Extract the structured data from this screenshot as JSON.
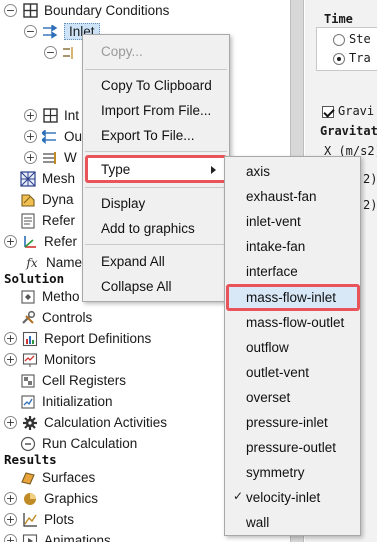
{
  "tree": {
    "boundary_conditions": "Boundary Conditions",
    "inlet": "Inlet",
    "interior_partial": "Int",
    "outlet_partial": "Ou",
    "wall_partial": "W",
    "mesh": "Mesh",
    "dynamic_partial": "Dyna",
    "reference_partial_1": "Refer",
    "reference_partial_2": "Refer",
    "named_partial": "Name",
    "solution_section": "Solution",
    "methods_partial": "Metho",
    "controls": "Controls",
    "report_definitions": "Report Definitions",
    "monitors": "Monitors",
    "cell_registers": "Cell Registers",
    "initialization": "Initialization",
    "calculation_activities": "Calculation Activities",
    "run_calculation": "Run Calculation",
    "results_section": "Results",
    "surfaces": "Surfaces",
    "graphics": "Graphics",
    "plots": "Plots",
    "animations": "Animations",
    "hidden_suffix": ")"
  },
  "panel": {
    "time_label": "Time",
    "steady_partial": "Ste",
    "transient_partial": "Tra",
    "gravity_partial": "Gravi",
    "gravitational_partial": "Gravitat",
    "x_label": "X (m/s2)",
    "y_partial": "2)",
    "z_partial": "2)"
  },
  "context_menu": {
    "copy": "Copy...",
    "copy_to_clipboard": "Copy To Clipboard",
    "import_from_file": "Import From File...",
    "export_to_file": "Export To File...",
    "type": "Type",
    "display": "Display",
    "add_to_graphics": "Add to graphics",
    "expand_all": "Expand All",
    "collapse_all": "Collapse All"
  },
  "type_submenu": {
    "items": [
      "axis",
      "exhaust-fan",
      "inlet-vent",
      "intake-fan",
      "interface",
      "mass-flow-inlet",
      "mass-flow-outlet",
      "outflow",
      "outlet-vent",
      "overset",
      "pressure-inlet",
      "pressure-outlet",
      "symmetry",
      "velocity-inlet",
      "wall"
    ],
    "checked": "velocity-inlet",
    "highlighted": "mass-flow-inlet",
    "checkmark": "✓"
  },
  "colors": {
    "highlight_border": "#e8545a",
    "selection_bg": "#cde3f7",
    "hover_bg": "#d9e8f7",
    "menu_bg": "#f0f0f0"
  }
}
